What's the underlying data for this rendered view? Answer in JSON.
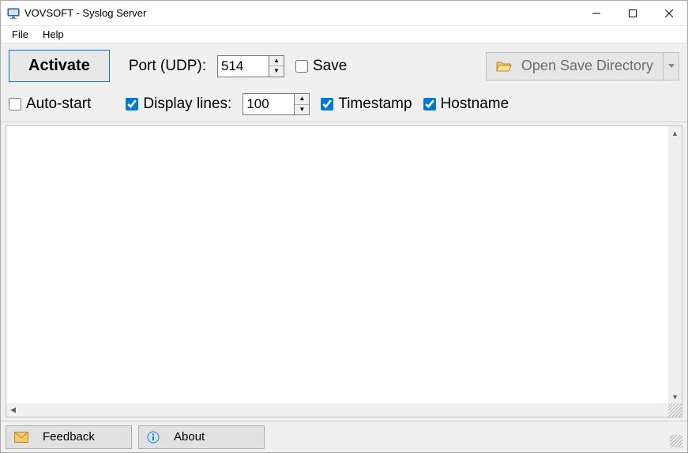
{
  "window": {
    "title": "VOVSOFT - Syslog Server"
  },
  "menu": {
    "file": "File",
    "help": "Help"
  },
  "toolbar": {
    "activate_label": "Activate",
    "port_label": "Port (UDP):",
    "port_value": "514",
    "save_label": "Save",
    "save_checked": false,
    "open_save_dir_label": "Open Save Directory",
    "autostart_label": "Auto-start",
    "autostart_checked": false,
    "display_lines_label": "Display lines:",
    "display_lines_checked": true,
    "display_lines_value": "100",
    "timestamp_label": "Timestamp",
    "timestamp_checked": true,
    "hostname_label": "Hostname",
    "hostname_checked": true
  },
  "status": {
    "feedback_label": "Feedback",
    "about_label": "About"
  }
}
